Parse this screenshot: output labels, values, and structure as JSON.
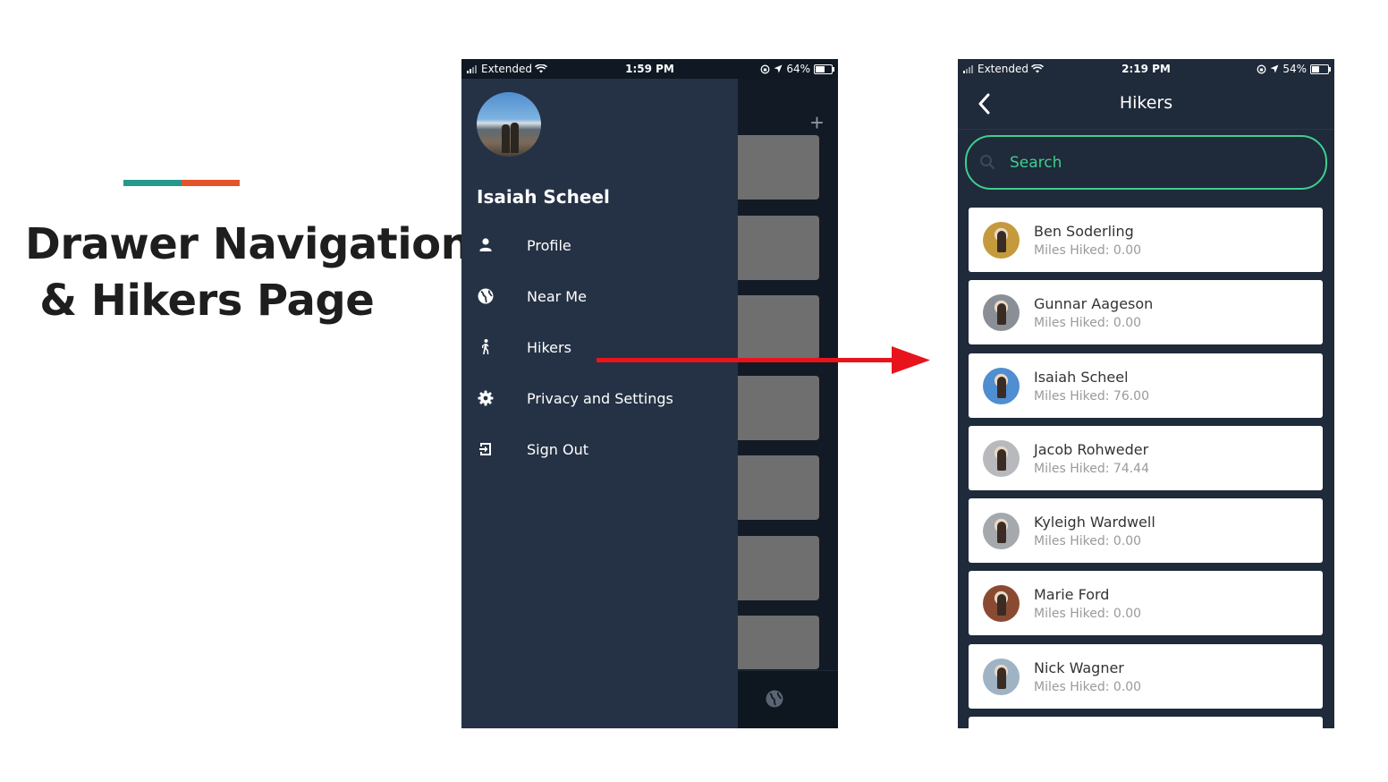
{
  "colors": {
    "accent_teal": "#24998c",
    "accent_orange": "#e5532b",
    "search_green": "#3ecf8e",
    "drawer_bg": "#253245",
    "arrow_red": "#e8141c"
  },
  "slide": {
    "title_line1": "Drawer Navigation",
    "title_line2": " & Hikers Page"
  },
  "phone1": {
    "status": {
      "carrier": "Extended",
      "time": "1:59 PM",
      "battery_label": "64%",
      "battery_level": 0.64
    },
    "profile_name": "Isaiah Scheel",
    "menu": [
      {
        "label": "Profile",
        "icon": "person-icon"
      },
      {
        "label": "Near Me",
        "icon": "globe-icon"
      },
      {
        "label": "Hikers",
        "icon": "hiker-icon"
      },
      {
        "label": "Privacy and Settings",
        "icon": "gear-icon"
      },
      {
        "label": "Sign Out",
        "icon": "sign-out-icon"
      }
    ],
    "background_app": {
      "plus_label": "+"
    }
  },
  "phone2": {
    "status": {
      "carrier": "Extended",
      "time": "2:19 PM",
      "battery_label": "54%",
      "battery_level": 0.54
    },
    "title": "Hikers",
    "search": {
      "placeholder": "Search"
    },
    "hikers": [
      {
        "name": "Ben Soderling",
        "miles": "Miles Hiked: 0.00",
        "avatar_color": "#c49a3c"
      },
      {
        "name": "Gunnar Aageson",
        "miles": "Miles Hiked: 0.00",
        "avatar_color": "#8a8f96"
      },
      {
        "name": "Isaiah Scheel",
        "miles": "Miles Hiked: 76.00",
        "avatar_color": "#4f8ed0"
      },
      {
        "name": "Jacob Rohweder",
        "miles": "Miles Hiked: 74.44",
        "avatar_color": "#b7b9bd"
      },
      {
        "name": "Kyleigh Wardwell",
        "miles": "Miles Hiked: 0.00",
        "avatar_color": "#a5a9ae"
      },
      {
        "name": "Marie Ford",
        "miles": "Miles Hiked: 0.00",
        "avatar_color": "#8a4a32"
      },
      {
        "name": "Nick Wagner",
        "miles": "Miles Hiked: 0.00",
        "avatar_color": "#9fb3c4"
      }
    ]
  }
}
